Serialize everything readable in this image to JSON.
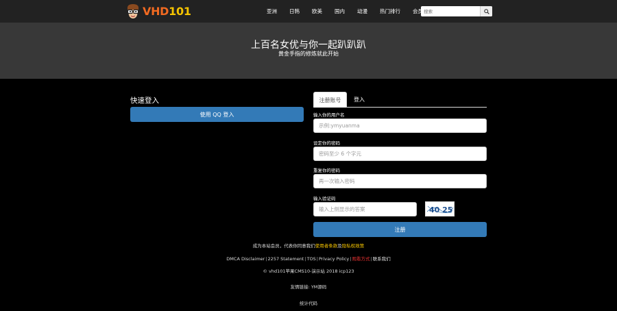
{
  "header": {
    "logo_text_a": "VHD",
    "logo_text_b": "101",
    "nav": [
      "亚洲",
      "日韩",
      "欧美",
      "国内",
      "动漫",
      "热门排行",
      "会员中心"
    ],
    "search_placeholder": "搜索",
    "icons": {
      "search": "search-icon",
      "logo": "glasses-face-logo"
    }
  },
  "banner": {
    "title": "上百名女优与你一起趴趴趴",
    "subtitle": "黄金手指的修炼就此开始"
  },
  "quick_login": {
    "title": "快速登入",
    "qq_button": "使用 QQ 登入"
  },
  "register": {
    "tabs": [
      "注册账号",
      "登入"
    ],
    "active_tab": 0,
    "username_label": "输入你的用户名",
    "username_placeholder": "示例:ymyuanma",
    "password_label": "设定你的密码",
    "password_placeholder": "密码至少 6 个字元",
    "confirm_label": "重复你的密码",
    "confirm_placeholder": "再一次输入密码",
    "captcha_label": "输入验证码",
    "captcha_placeholder": "输入上侧显示的答案",
    "captcha_text": "40 25",
    "submit": "注册"
  },
  "footer": {
    "terms_prefix": "成为本站会员，代表你同意我们",
    "terms_link": "使用者条款",
    "terms_and": "及",
    "privacy_link": "隐私权政策",
    "links": [
      "DMCA Disclaimer",
      "2257 Statement",
      "TOS",
      "Privacy Policy",
      "观看方式",
      "联系我们"
    ],
    "copyright": "© vhd101苹果CMS10-演示站 2018 icp123",
    "friend_links": "友情链接: YM源码",
    "stats": "统计代码"
  },
  "colors": {
    "primary_button": "#337ab7",
    "logo_orange": "#f26a21",
    "logo_yellow": "#f5c400",
    "header_bg": "#222222",
    "banner_bg": "#383838",
    "highlight_red": "#ee3333"
  }
}
